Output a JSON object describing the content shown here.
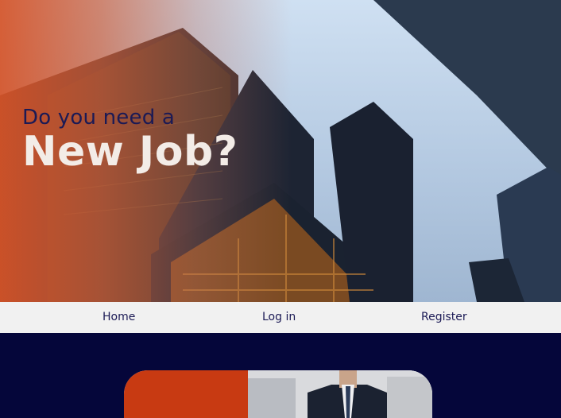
{
  "hero": {
    "kicker": "Do you need a",
    "title": "New Job?"
  },
  "nav": {
    "items": [
      {
        "label": "Home"
      },
      {
        "label": "Log in"
      },
      {
        "label": "Register"
      }
    ]
  },
  "colors": {
    "brand_navy": "#05063a",
    "accent_orange": "#c83a12",
    "nav_bg": "#f1f1f1",
    "hero_title": "#f3ece7",
    "nav_text": "#1b1a55"
  }
}
